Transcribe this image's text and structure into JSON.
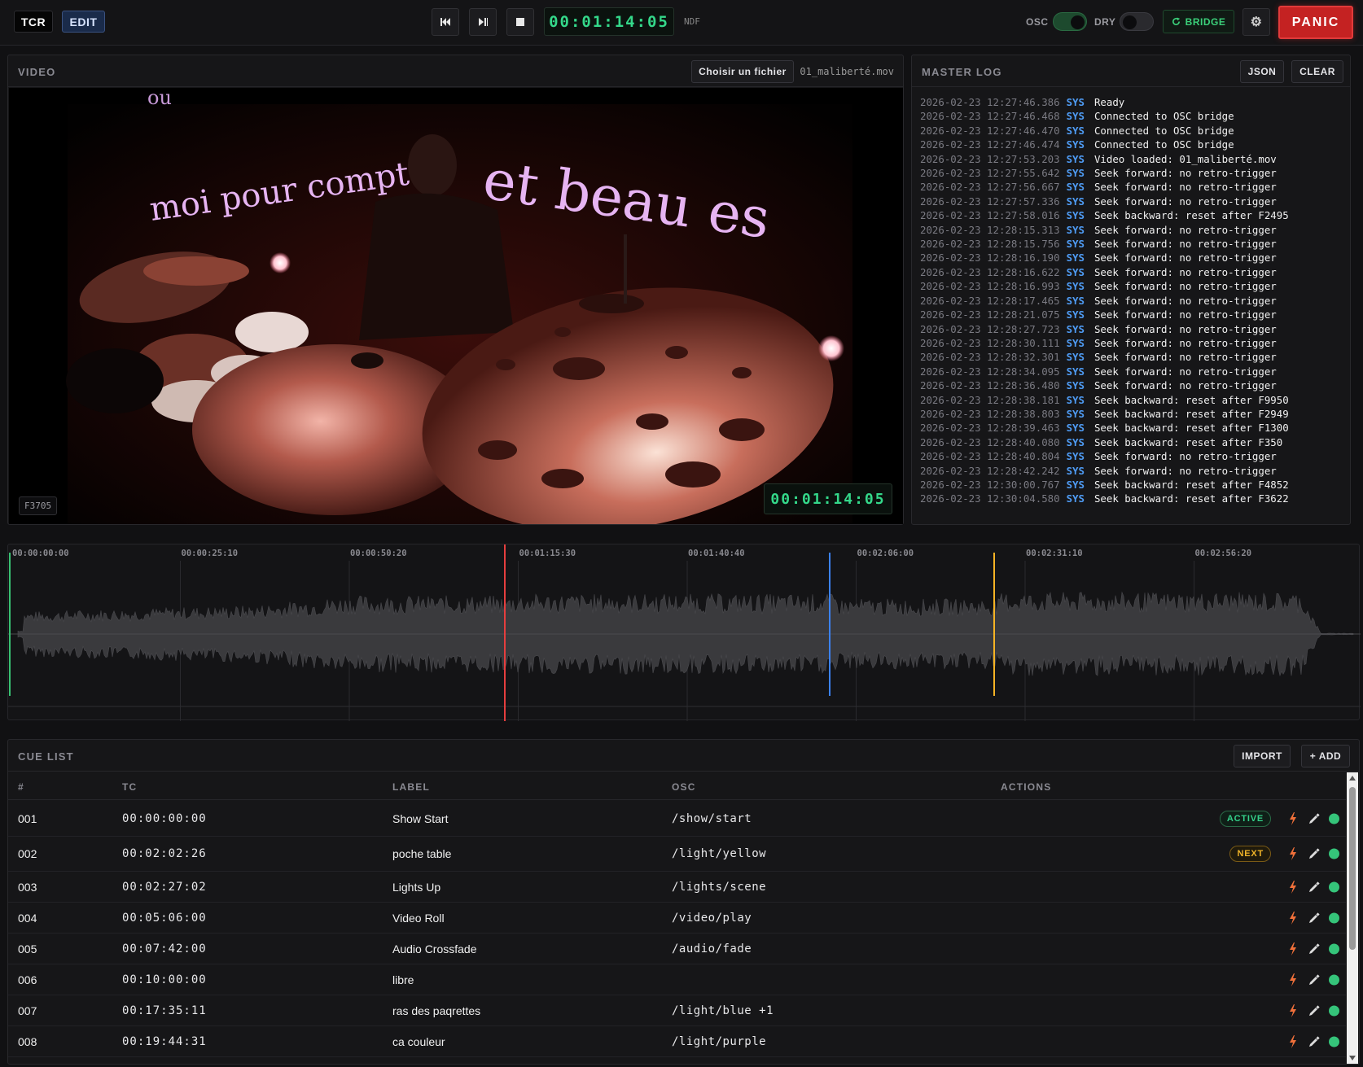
{
  "topbar": {
    "tcr_label": "TCR",
    "edit_label": "EDIT",
    "timecode": "00:01:14:05",
    "ndf_label": "NDF",
    "osc_label": "OSC",
    "dry_label": "DRY",
    "osc_on": true,
    "dry_on": false,
    "bridge_label": "BRIDGE",
    "panic_label": "PANIC",
    "icons": [
      "rewind-icon",
      "step-icon",
      "stop-icon",
      "refresh-icon",
      "gear-icon"
    ]
  },
  "video": {
    "title": "VIDEO",
    "choose_file_label": "Choisir un fichier",
    "file_name": "01_maliberté.mov",
    "frame_label": "F3705",
    "timecode": "00:01:14:05",
    "overlay_text": {
      "line1": "moi pour compt",
      "line2": "et beau es",
      "corner": "ou"
    }
  },
  "log": {
    "title": "MASTER LOG",
    "json_label": "JSON",
    "clear_label": "CLEAR",
    "entries": [
      {
        "ts": "2026-02-23 12:27:46.386",
        "tag": "SYS",
        "msg": "Ready"
      },
      {
        "ts": "2026-02-23 12:27:46.468",
        "tag": "SYS",
        "msg": "Connected to OSC bridge"
      },
      {
        "ts": "2026-02-23 12:27:46.470",
        "tag": "SYS",
        "msg": "Connected to OSC bridge"
      },
      {
        "ts": "2026-02-23 12:27:46.474",
        "tag": "SYS",
        "msg": "Connected to OSC bridge"
      },
      {
        "ts": "2026-02-23 12:27:53.203",
        "tag": "SYS",
        "msg": "Video loaded: 01_maliberté.mov"
      },
      {
        "ts": "2026-02-23 12:27:55.642",
        "tag": "SYS",
        "msg": "Seek forward: no retro-trigger"
      },
      {
        "ts": "2026-02-23 12:27:56.667",
        "tag": "SYS",
        "msg": "Seek forward: no retro-trigger"
      },
      {
        "ts": "2026-02-23 12:27:57.336",
        "tag": "SYS",
        "msg": "Seek forward: no retro-trigger"
      },
      {
        "ts": "2026-02-23 12:27:58.016",
        "tag": "SYS",
        "msg": "Seek backward: reset after F2495"
      },
      {
        "ts": "2026-02-23 12:28:15.313",
        "tag": "SYS",
        "msg": "Seek forward: no retro-trigger"
      },
      {
        "ts": "2026-02-23 12:28:15.756",
        "tag": "SYS",
        "msg": "Seek forward: no retro-trigger"
      },
      {
        "ts": "2026-02-23 12:28:16.190",
        "tag": "SYS",
        "msg": "Seek forward: no retro-trigger"
      },
      {
        "ts": "2026-02-23 12:28:16.622",
        "tag": "SYS",
        "msg": "Seek forward: no retro-trigger"
      },
      {
        "ts": "2026-02-23 12:28:16.993",
        "tag": "SYS",
        "msg": "Seek forward: no retro-trigger"
      },
      {
        "ts": "2026-02-23 12:28:17.465",
        "tag": "SYS",
        "msg": "Seek forward: no retro-trigger"
      },
      {
        "ts": "2026-02-23 12:28:21.075",
        "tag": "SYS",
        "msg": "Seek forward: no retro-trigger"
      },
      {
        "ts": "2026-02-23 12:28:27.723",
        "tag": "SYS",
        "msg": "Seek forward: no retro-trigger"
      },
      {
        "ts": "2026-02-23 12:28:30.111",
        "tag": "SYS",
        "msg": "Seek forward: no retro-trigger"
      },
      {
        "ts": "2026-02-23 12:28:32.301",
        "tag": "SYS",
        "msg": "Seek forward: no retro-trigger"
      },
      {
        "ts": "2026-02-23 12:28:34.095",
        "tag": "SYS",
        "msg": "Seek forward: no retro-trigger"
      },
      {
        "ts": "2026-02-23 12:28:36.480",
        "tag": "SYS",
        "msg": "Seek forward: no retro-trigger"
      },
      {
        "ts": "2026-02-23 12:28:38.181",
        "tag": "SYS",
        "msg": "Seek backward: reset after F9950"
      },
      {
        "ts": "2026-02-23 12:28:38.803",
        "tag": "SYS",
        "msg": "Seek backward: reset after F2949"
      },
      {
        "ts": "2026-02-23 12:28:39.463",
        "tag": "SYS",
        "msg": "Seek backward: reset after F1300"
      },
      {
        "ts": "2026-02-23 12:28:40.080",
        "tag": "SYS",
        "msg": "Seek backward: reset after F350"
      },
      {
        "ts": "2026-02-23 12:28:40.804",
        "tag": "SYS",
        "msg": "Seek forward: no retro-trigger"
      },
      {
        "ts": "2026-02-23 12:28:42.242",
        "tag": "SYS",
        "msg": "Seek forward: no retro-trigger"
      },
      {
        "ts": "2026-02-23 12:30:00.767",
        "tag": "SYS",
        "msg": "Seek backward: reset after F4852"
      },
      {
        "ts": "2026-02-23 12:30:04.580",
        "tag": "SYS",
        "msg": "Seek backward: reset after F3622"
      }
    ]
  },
  "timeline": {
    "ruler_labels": [
      "00:00:00:00",
      "00:00:25:10",
      "00:00:50:20",
      "00:01:15:30",
      "00:01:40:40",
      "00:02:06:00",
      "00:02:31:10",
      "00:02:56:20"
    ],
    "playhead_color": "#e53e3e",
    "start_marker_color": "#38c172",
    "cue_marker_colors": [
      "#3b82f6",
      "#f5b324"
    ]
  },
  "cues": {
    "title": "CUE LIST",
    "import_label": "IMPORT",
    "add_label": "+ ADD",
    "headers": {
      "num": "#",
      "tc": "TC",
      "label": "LABEL",
      "osc": "OSC",
      "actions": "ACTIONS"
    },
    "rows": [
      {
        "num": "001",
        "tc": "00:00:00:00",
        "label": "Show Start",
        "osc": "/show/start",
        "badge": "ACTIVE"
      },
      {
        "num": "002",
        "tc": "00:02:02:26",
        "label": "poche table",
        "osc": "/light/yellow",
        "badge": "NEXT"
      },
      {
        "num": "003",
        "tc": "00:02:27:02",
        "label": "Lights Up",
        "osc": "/lights/scene",
        "badge": ""
      },
      {
        "num": "004",
        "tc": "00:05:06:00",
        "label": "Video Roll",
        "osc": "/video/play",
        "badge": ""
      },
      {
        "num": "005",
        "tc": "00:07:42:00",
        "label": "Audio Crossfade",
        "osc": "/audio/fade",
        "badge": ""
      },
      {
        "num": "006",
        "tc": "00:10:00:00",
        "label": "libre",
        "osc": "",
        "badge": ""
      },
      {
        "num": "007",
        "tc": "00:17:35:11",
        "label": "ras des paqrettes",
        "osc": "/light/blue +1",
        "badge": ""
      },
      {
        "num": "008",
        "tc": "00:19:44:31",
        "label": "ca couleur",
        "osc": "/light/purple",
        "badge": ""
      }
    ]
  }
}
